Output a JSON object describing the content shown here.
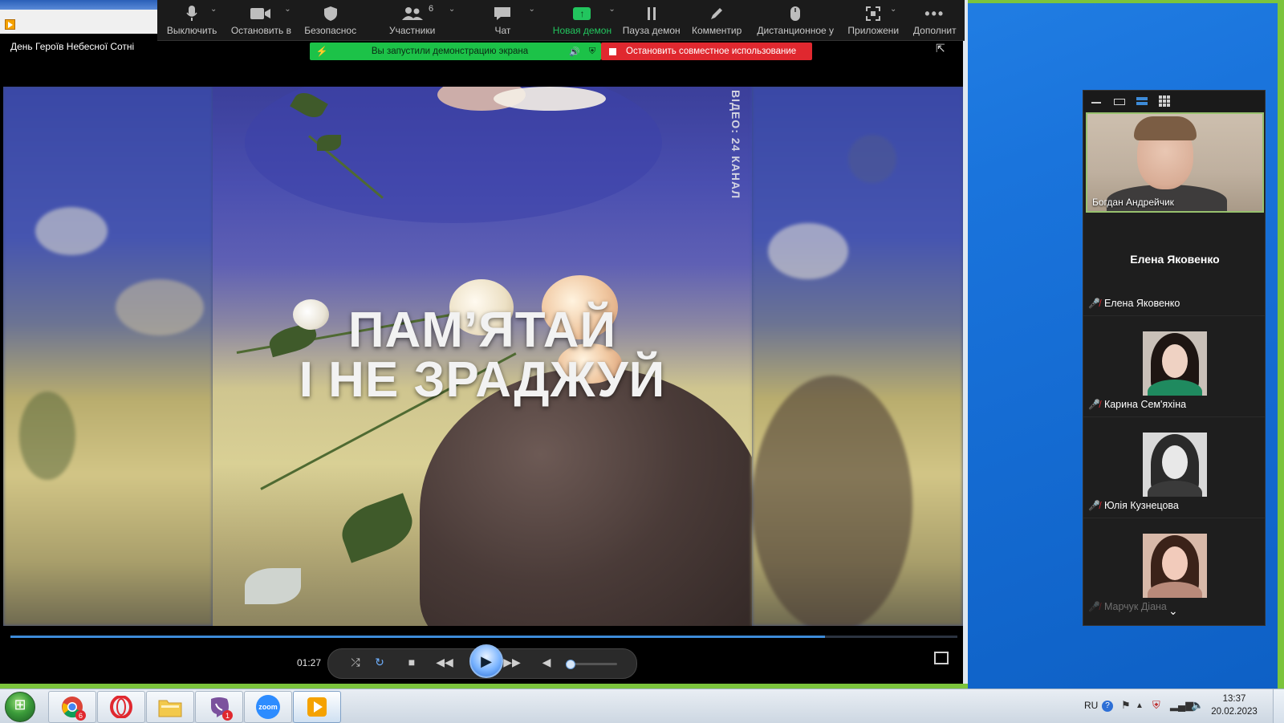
{
  "video_title": "День Героїв Небесної Сотні",
  "zoom_toolbar": {
    "participants_count": "6",
    "buttons": [
      {
        "label": "Выключить",
        "icon": "microphone-icon"
      },
      {
        "label": "Остановить в",
        "icon": "video-camera-icon"
      },
      {
        "label": "Безопаснос",
        "icon": "shield-icon"
      },
      {
        "label": "Участники",
        "icon": "participants-icon"
      },
      {
        "label": "Чат",
        "icon": "chat-icon"
      },
      {
        "label": "Новая демон",
        "icon": "share-screen-icon"
      },
      {
        "label": "Пауза демон",
        "icon": "pause-icon"
      },
      {
        "label": "Комментир",
        "icon": "pen-icon"
      },
      {
        "label": "Дистанционное у",
        "icon": "mouse-icon"
      },
      {
        "label": "Приложени",
        "icon": "apps-icon"
      },
      {
        "label": "Дополнит",
        "icon": "more-icon"
      }
    ],
    "accent_green": "#22c55e"
  },
  "share_banner": {
    "text": "Вы запустили демонстрацию экрана",
    "stop_text": "Остановить совместное использование",
    "banner_color": "#1cc248",
    "stop_color": "#e0282f"
  },
  "video_overlay": {
    "line1": "ПАМ’ЯТАЙ",
    "line2": "І НЕ ЗРАДЖУЙ",
    "watermark": "ВІДЕО: 24 КАНАЛ"
  },
  "player": {
    "time": "01:27",
    "progress_fraction": 0.86,
    "volume_fraction": 0.08
  },
  "zoom_panel": {
    "active_speaker": "Богдан Андрейчик",
    "dark_tile_name": "Елена Яковенко",
    "participants": [
      {
        "name": "Елена Яковенко"
      },
      {
        "name": "Карина Сем'яхіна"
      },
      {
        "name": "Юлія Кузнецова"
      },
      {
        "name": "Марчук Діана"
      }
    ]
  },
  "taskbar": {
    "language": "RU",
    "time": "13:37",
    "date": "20.02.2023",
    "chrome_badge": "6",
    "viber_badge": "1",
    "zoom_label": "zoom",
    "apps": [
      "chrome",
      "opera",
      "explorer",
      "viber",
      "zoom",
      "media-player"
    ]
  }
}
